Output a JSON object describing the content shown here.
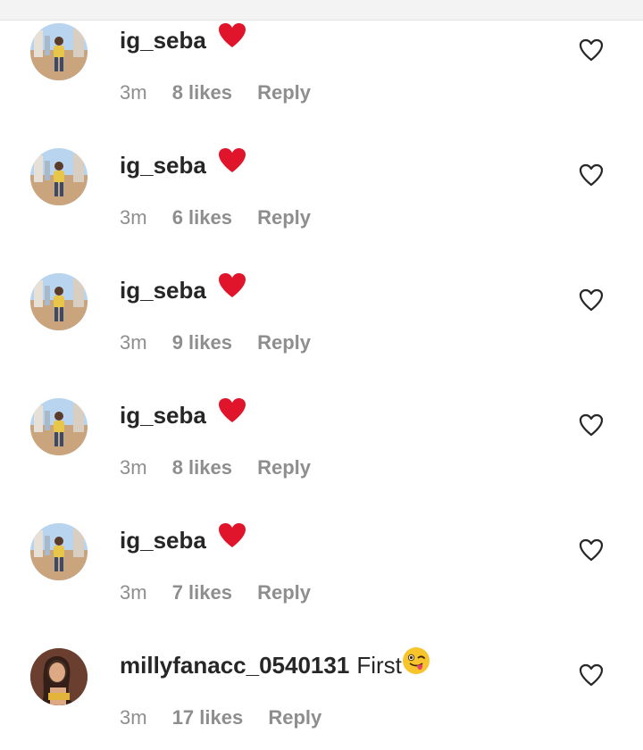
{
  "comments": [
    {
      "username": "ig_seba",
      "text": "",
      "emoji": "red-heart",
      "time": "3m",
      "likes": "8 likes",
      "reply": "Reply",
      "avatar": "man-city-street-avatar"
    },
    {
      "username": "ig_seba",
      "text": "",
      "emoji": "red-heart",
      "time": "3m",
      "likes": "6 likes",
      "reply": "Reply",
      "avatar": "man-city-street-avatar"
    },
    {
      "username": "ig_seba",
      "text": "",
      "emoji": "red-heart",
      "time": "3m",
      "likes": "9 likes",
      "reply": "Reply",
      "avatar": "man-city-street-avatar"
    },
    {
      "username": "ig_seba",
      "text": "",
      "emoji": "red-heart",
      "time": "3m",
      "likes": "8 likes",
      "reply": "Reply",
      "avatar": "man-city-street-avatar"
    },
    {
      "username": "ig_seba",
      "text": "",
      "emoji": "red-heart",
      "time": "3m",
      "likes": "7 likes",
      "reply": "Reply",
      "avatar": "man-city-street-avatar"
    },
    {
      "username": "millyfanacc_0540131",
      "text": "First",
      "emoji": "winking-tongue-face",
      "time": "3m",
      "likes": "17 likes",
      "reply": "Reply",
      "avatar": "woman-portrait-avatar"
    }
  ],
  "icons": {
    "like": "heart-outline-icon"
  },
  "colors": {
    "username": "#262626",
    "meta": "#8e8e8e",
    "heart_emoji": "#e0142b",
    "background": "#ffffff"
  }
}
